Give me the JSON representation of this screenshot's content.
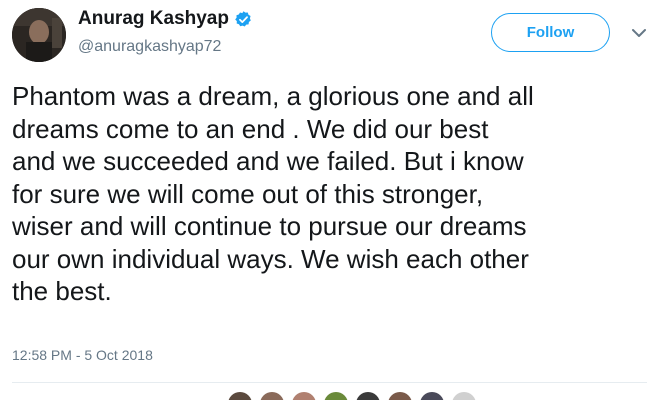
{
  "author": {
    "name": "Anurag Kashyap",
    "handle": "@anuragkashyap72",
    "verified": true,
    "avatar_icon": "profile-photo"
  },
  "follow_button": {
    "label": "Follow",
    "color": "#1da1f2"
  },
  "menu_icon": "chevron-down-icon",
  "tweet": {
    "lines": [
      "Phantom was a dream, a glorious one and all",
      "dreams come to an end . We did our best",
      "and we succeeded and we failed. But i know",
      "for sure we will come out of this stronger,",
      "wiser and will continue to pursue our dreams",
      "our own individual ways. We wish each other",
      "the best."
    ],
    "timestamp": "12:58 PM - 5 Oct 2018"
  },
  "colors": {
    "text": "#14171a",
    "secondary": "#657786",
    "accent": "#1da1f2",
    "divider": "#e6ecf0"
  },
  "likers": [
    {
      "color": "#5b4a3e"
    },
    {
      "color": "#8a6a5a"
    },
    {
      "color": "#b08070"
    },
    {
      "color": "#6a8a3a"
    },
    {
      "color": "#3a3a3a"
    },
    {
      "color": "#7a5a4a"
    },
    {
      "color": "#4a4a5a"
    },
    {
      "color": "#d0d0d0"
    }
  ]
}
